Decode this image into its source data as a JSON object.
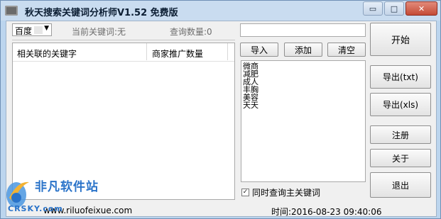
{
  "window": {
    "title": "秋天搜索关键词分析师V1.52 免费版",
    "buttons": {
      "minimize": "▭",
      "maximize": "□",
      "close": "✕"
    }
  },
  "toolbar": {
    "engine_value": "百度",
    "current_keyword_label": "当前关键词:无",
    "query_count_label": "查询数量:0"
  },
  "results_table": {
    "columns": [
      "相关联的关键字",
      "商家推广数量"
    ],
    "rows": []
  },
  "keyword_input": {
    "value": ""
  },
  "keyword_buttons": {
    "import": "导入",
    "add": "添加",
    "clear": "清空"
  },
  "keywords": [
    "微商",
    "减肥",
    "成人",
    "丰胸",
    "美容",
    "天天"
  ],
  "query_main_checkbox": {
    "checked": true,
    "label": "同时查询主关键词"
  },
  "right_buttons": {
    "start": "开始",
    "export_txt": "导出(txt)",
    "export_xls": "导出(xls)",
    "register": "注册",
    "about": "关于",
    "exit": "退出"
  },
  "footer": {
    "url": "www.riluofeixue.com",
    "time": "时间:2016-08-23 09:40:06"
  },
  "watermark": {
    "logo_text": "非凡软件站",
    "sub_text": "CRSKY.com"
  }
}
